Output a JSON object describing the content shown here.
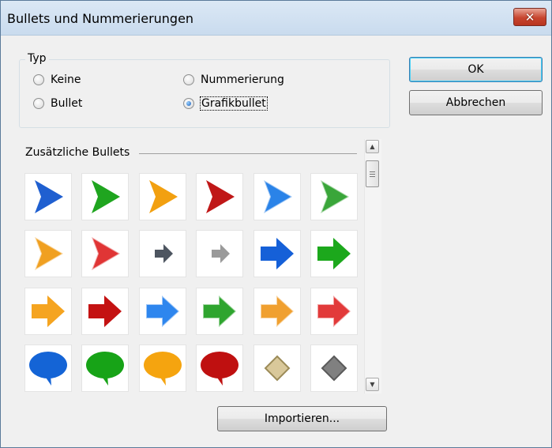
{
  "window": {
    "title": "Bullets und Nummerierungen",
    "close_glyph": "✕"
  },
  "type_group": {
    "label": "Typ",
    "options": [
      {
        "label": "Keine",
        "checked": false
      },
      {
        "label": "Nummerierung",
        "checked": false
      },
      {
        "label": "Bullet",
        "checked": false
      },
      {
        "label": "Grafikbullet",
        "checked": true
      }
    ]
  },
  "buttons": {
    "ok": "OK",
    "cancel": "Abbrechen",
    "import": "Importieren..."
  },
  "additional": {
    "label": "Zusätzliche Bullets",
    "rows": [
      [
        {
          "icon": "triangle-arrow-blue",
          "color": "#1f5fd0"
        },
        {
          "icon": "triangle-arrow-green",
          "color": "#1fa51f"
        },
        {
          "icon": "triangle-arrow-orange",
          "color": "#f2a010"
        },
        {
          "icon": "triangle-arrow-red",
          "color": "#c01818"
        },
        {
          "icon": "triangle-arrow-blue-glossy",
          "color": "#2a83e8"
        },
        {
          "icon": "triangle-arrow-green-glossy",
          "color": "#3aa63a"
        }
      ],
      [
        {
          "icon": "triangle-arrow-orange-glossy",
          "color": "#f0a021"
        },
        {
          "icon": "triangle-arrow-red-glossy",
          "color": "#e03535"
        },
        {
          "icon": "small-arrow-dark-gray",
          "color": "#4d5560"
        },
        {
          "icon": "small-arrow-gray",
          "color": "#9a9a9a"
        },
        {
          "icon": "block-arrow-blue",
          "color": "#1560d8"
        },
        {
          "icon": "block-arrow-green",
          "color": "#1ca81c"
        }
      ],
      [
        {
          "icon": "block-arrow-orange",
          "color": "#f5a420"
        },
        {
          "icon": "block-arrow-red",
          "color": "#c41212"
        },
        {
          "icon": "block-arrow-blue-glossy",
          "color": "#2e86ee"
        },
        {
          "icon": "block-arrow-green-glossy",
          "color": "#2fa52f"
        },
        {
          "icon": "block-arrow-orange-glossy",
          "color": "#f0a030"
        },
        {
          "icon": "block-arrow-red-glossy",
          "color": "#e23a3a"
        }
      ],
      [
        {
          "icon": "speech-bubble-blue",
          "color": "#1464d6"
        },
        {
          "icon": "speech-bubble-green",
          "color": "#17a317"
        },
        {
          "icon": "speech-bubble-orange",
          "color": "#f5a40f"
        },
        {
          "icon": "speech-bubble-red",
          "color": "#bf1010"
        },
        {
          "icon": "diamond-beige",
          "color": "#d9c89a"
        },
        {
          "icon": "diamond-gray",
          "color": "#808080"
        }
      ]
    ]
  }
}
